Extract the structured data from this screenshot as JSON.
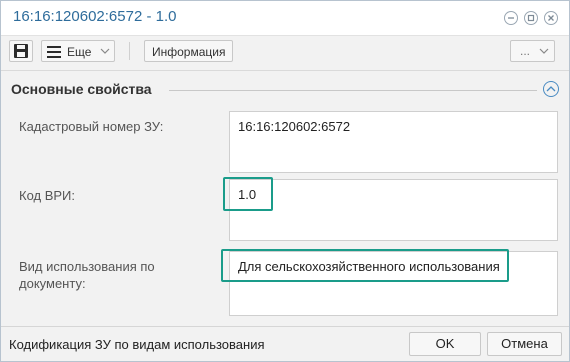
{
  "window": {
    "title": "16:16:120602:6572 - 1.0"
  },
  "toolbar": {
    "save_icon": "save-icon",
    "more_label": "Еще",
    "info_label": "Информация",
    "extra_label": "..."
  },
  "section": {
    "title": "Основные свойства"
  },
  "fields": [
    {
      "label": "Кадастровый номер ЗУ:",
      "value": "16:16:120602:6572"
    },
    {
      "label": "Код ВРИ:",
      "value": "1.0"
    },
    {
      "label": "Вид использования по документу:",
      "value": "Для сельскохозяйственного использования"
    }
  ],
  "footer": {
    "status": "Кодификация ЗУ по видам использования",
    "ok_label": "OK",
    "cancel_label": "Отмена"
  },
  "colors": {
    "title": "#2e6c9b",
    "highlight": "#1a9c8a",
    "accent": "#4a8bc2"
  }
}
